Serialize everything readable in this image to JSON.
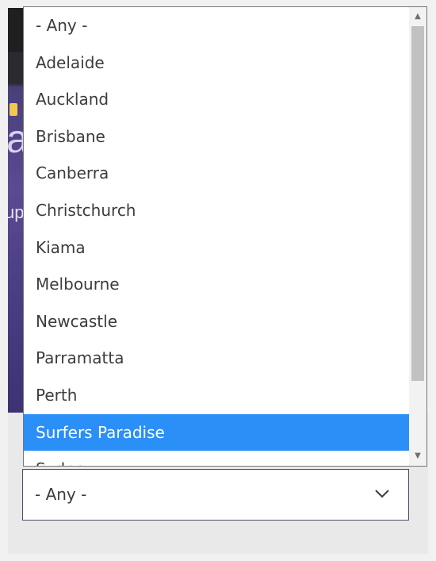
{
  "dropdown": {
    "options": [
      "- Any -",
      "Adelaide",
      "Auckland",
      "Brisbane",
      "Canberra",
      "Christchurch",
      "Kiama",
      "Melbourne",
      "Newcastle",
      "Parramatta",
      "Perth",
      "Surfers Paradise",
      "Sydney"
    ],
    "highlighted": "Surfers Paradise"
  },
  "select": {
    "value": "- Any -"
  },
  "background": {
    "hero_letter": "a",
    "hero_text": "up"
  },
  "colors": {
    "highlight": "#2a8ff7",
    "hero": "#4a3f7a"
  }
}
